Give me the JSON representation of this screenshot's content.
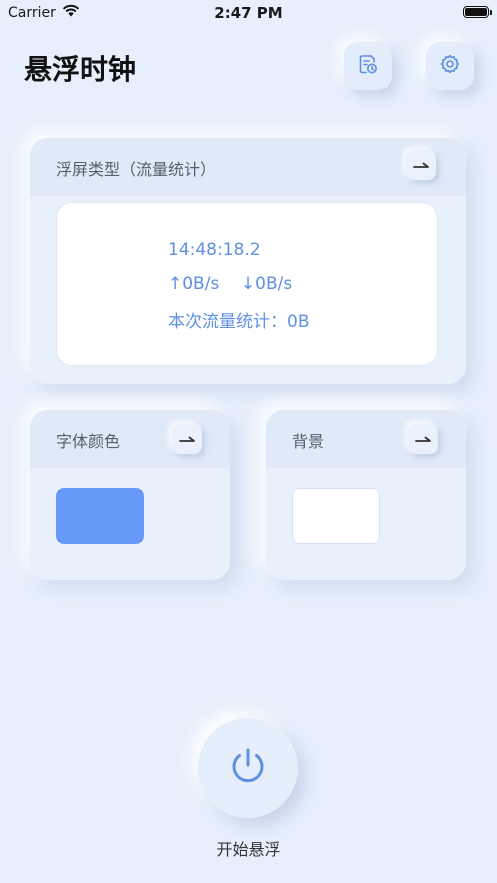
{
  "status_bar": {
    "carrier": "Carrier",
    "time": "2:47 PM"
  },
  "header": {
    "title": "悬浮时钟",
    "icons": [
      "history-doc-icon",
      "gear-icon"
    ]
  },
  "float_type_card": {
    "title": "浮屏类型（流量统计）",
    "preview": {
      "time": "14:48:18.2",
      "speed": "↑0B/s    ↓0B/s",
      "traffic": "本次流量统计：0B"
    }
  },
  "font_color_card": {
    "title": "字体颜色",
    "swatch_color": "#6699fa"
  },
  "background_card": {
    "title": "背景",
    "swatch_color": "#ffffff"
  },
  "start": {
    "label": "开始悬浮",
    "icon": "power-icon"
  },
  "colors": {
    "accent": "#5f8fe3",
    "background": "#e6effb"
  }
}
